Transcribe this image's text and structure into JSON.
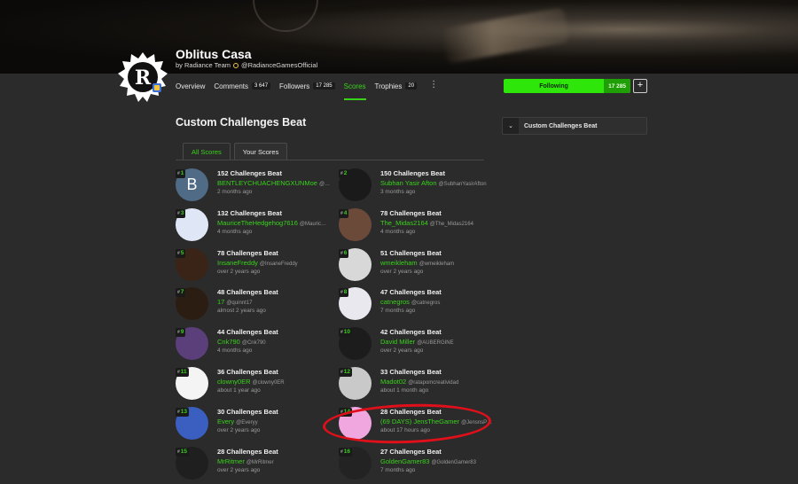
{
  "game": {
    "title": "Oblitus Casa",
    "by_prefix": "by Radiance Team",
    "handle": "@RadianceGamesOfficial",
    "logo_letter": "R"
  },
  "tabs": [
    {
      "label": "Overview",
      "count": ""
    },
    {
      "label": "Comments",
      "count": "3 647"
    },
    {
      "label": "Followers",
      "count": "17 285"
    },
    {
      "label": "Scores",
      "count": "",
      "active": true
    },
    {
      "label": "Trophies",
      "count": "20"
    }
  ],
  "follow": {
    "label": "Following",
    "count": "17 285",
    "plus": "+"
  },
  "section_title": "Custom Challenges Beat",
  "sub_tabs": [
    "All Scores",
    "Your Scores"
  ],
  "side_panel": {
    "title": "Custom Challenges Beat",
    "icon": "chevron-down-icon"
  },
  "entries": [
    {
      "rank": "1",
      "score": "152 Challenges Beat",
      "name": "BENTLEYCHUACHENGXUNMoe",
      "handle": "@…",
      "time": "2 months ago",
      "avatar_color": "#4f6b85",
      "avatar_letter": "B"
    },
    {
      "rank": "2",
      "score": "150 Challenges Beat",
      "name": "Subhan Yasir Afton",
      "handle": "@SubhanYasirAfton",
      "time": "3 months ago",
      "avatar_color": "#1a1a1a",
      "avatar_letter": ""
    },
    {
      "rank": "3",
      "score": "132 Challenges Beat",
      "name": "MauriceTheHedgehog7616",
      "handle": "@Mauric…",
      "time": "4 months ago",
      "avatar_color": "#dfe6f5",
      "avatar_letter": ""
    },
    {
      "rank": "4",
      "score": "78 Challenges Beat",
      "name": "The_Midas2164",
      "handle": "@The_Midas2164",
      "time": "4 months ago",
      "avatar_color": "#6b4a3a",
      "avatar_letter": ""
    },
    {
      "rank": "5",
      "score": "78 Challenges Beat",
      "name": "InsaneFreddy",
      "handle": "@InsaneFreddy",
      "time": "over 2 years ago",
      "avatar_color": "#3a2418",
      "avatar_letter": ""
    },
    {
      "rank": "6",
      "score": "51 Challenges Beat",
      "name": "wmeikleham",
      "handle": "@wmeikleham",
      "time": "over 2 years ago",
      "avatar_color": "#d8d8d8",
      "avatar_letter": ""
    },
    {
      "rank": "7",
      "score": "48 Challenges Beat",
      "name": "17",
      "handle": "@quinnt17",
      "time": "almost 2 years ago",
      "avatar_color": "#2b1d12",
      "avatar_letter": ""
    },
    {
      "rank": "8",
      "score": "47 Challenges Beat",
      "name": "catnegros",
      "handle": "@catnegros",
      "time": "7 months ago",
      "avatar_color": "#e8e8ee",
      "avatar_letter": ""
    },
    {
      "rank": "9",
      "score": "44 Challenges Beat",
      "name": "Cnk790",
      "handle": "@Cnk790",
      "time": "4 months ago",
      "avatar_color": "#5a3f7a",
      "avatar_letter": ""
    },
    {
      "rank": "10",
      "score": "42 Challenges Beat",
      "name": "David Miller",
      "handle": "@AUBERGINE",
      "time": "over 2 years ago",
      "avatar_color": "#1c1c1c",
      "avatar_letter": ""
    },
    {
      "rank": "11",
      "score": "36 Challenges Beat",
      "name": "clowny0ER",
      "handle": "@clowny0ER",
      "time": "about 1 year ago",
      "avatar_color": "#f4f4f4",
      "avatar_letter": ""
    },
    {
      "rank": "12",
      "score": "33 Challenges Beat",
      "name": "Madot02",
      "handle": "@ratapomcreatividad",
      "time": "about 1 month ago",
      "avatar_color": "#c9c9c9",
      "avatar_letter": ""
    },
    {
      "rank": "13",
      "score": "30 Challenges Beat",
      "name": "Every",
      "handle": "@Everyy",
      "time": "over 2 years ago",
      "avatar_color": "#3b5fc0",
      "avatar_letter": ""
    },
    {
      "rank": "14",
      "score": "28 Challenges Beat",
      "name": "(69 DAYS) JensTheGamer",
      "handle": "@JensnsP…",
      "time": "about 17 hours ago",
      "avatar_color": "#f0a7e0",
      "avatar_letter": ""
    },
    {
      "rank": "15",
      "score": "28 Challenges Beat",
      "name": "MrRitmer",
      "handle": "@MrRitmer",
      "time": "over 2 years ago",
      "avatar_color": "#1f1f1f",
      "avatar_letter": ""
    },
    {
      "rank": "16",
      "score": "27 Challenges Beat",
      "name": "GoldenGamer83",
      "handle": "@GoldenGamer83",
      "time": "7 months ago",
      "avatar_color": "#232323",
      "avatar_letter": ""
    }
  ],
  "colors": {
    "accent": "#39d21a",
    "bg": "#2b2b2c",
    "annotation": "#e0101a"
  }
}
